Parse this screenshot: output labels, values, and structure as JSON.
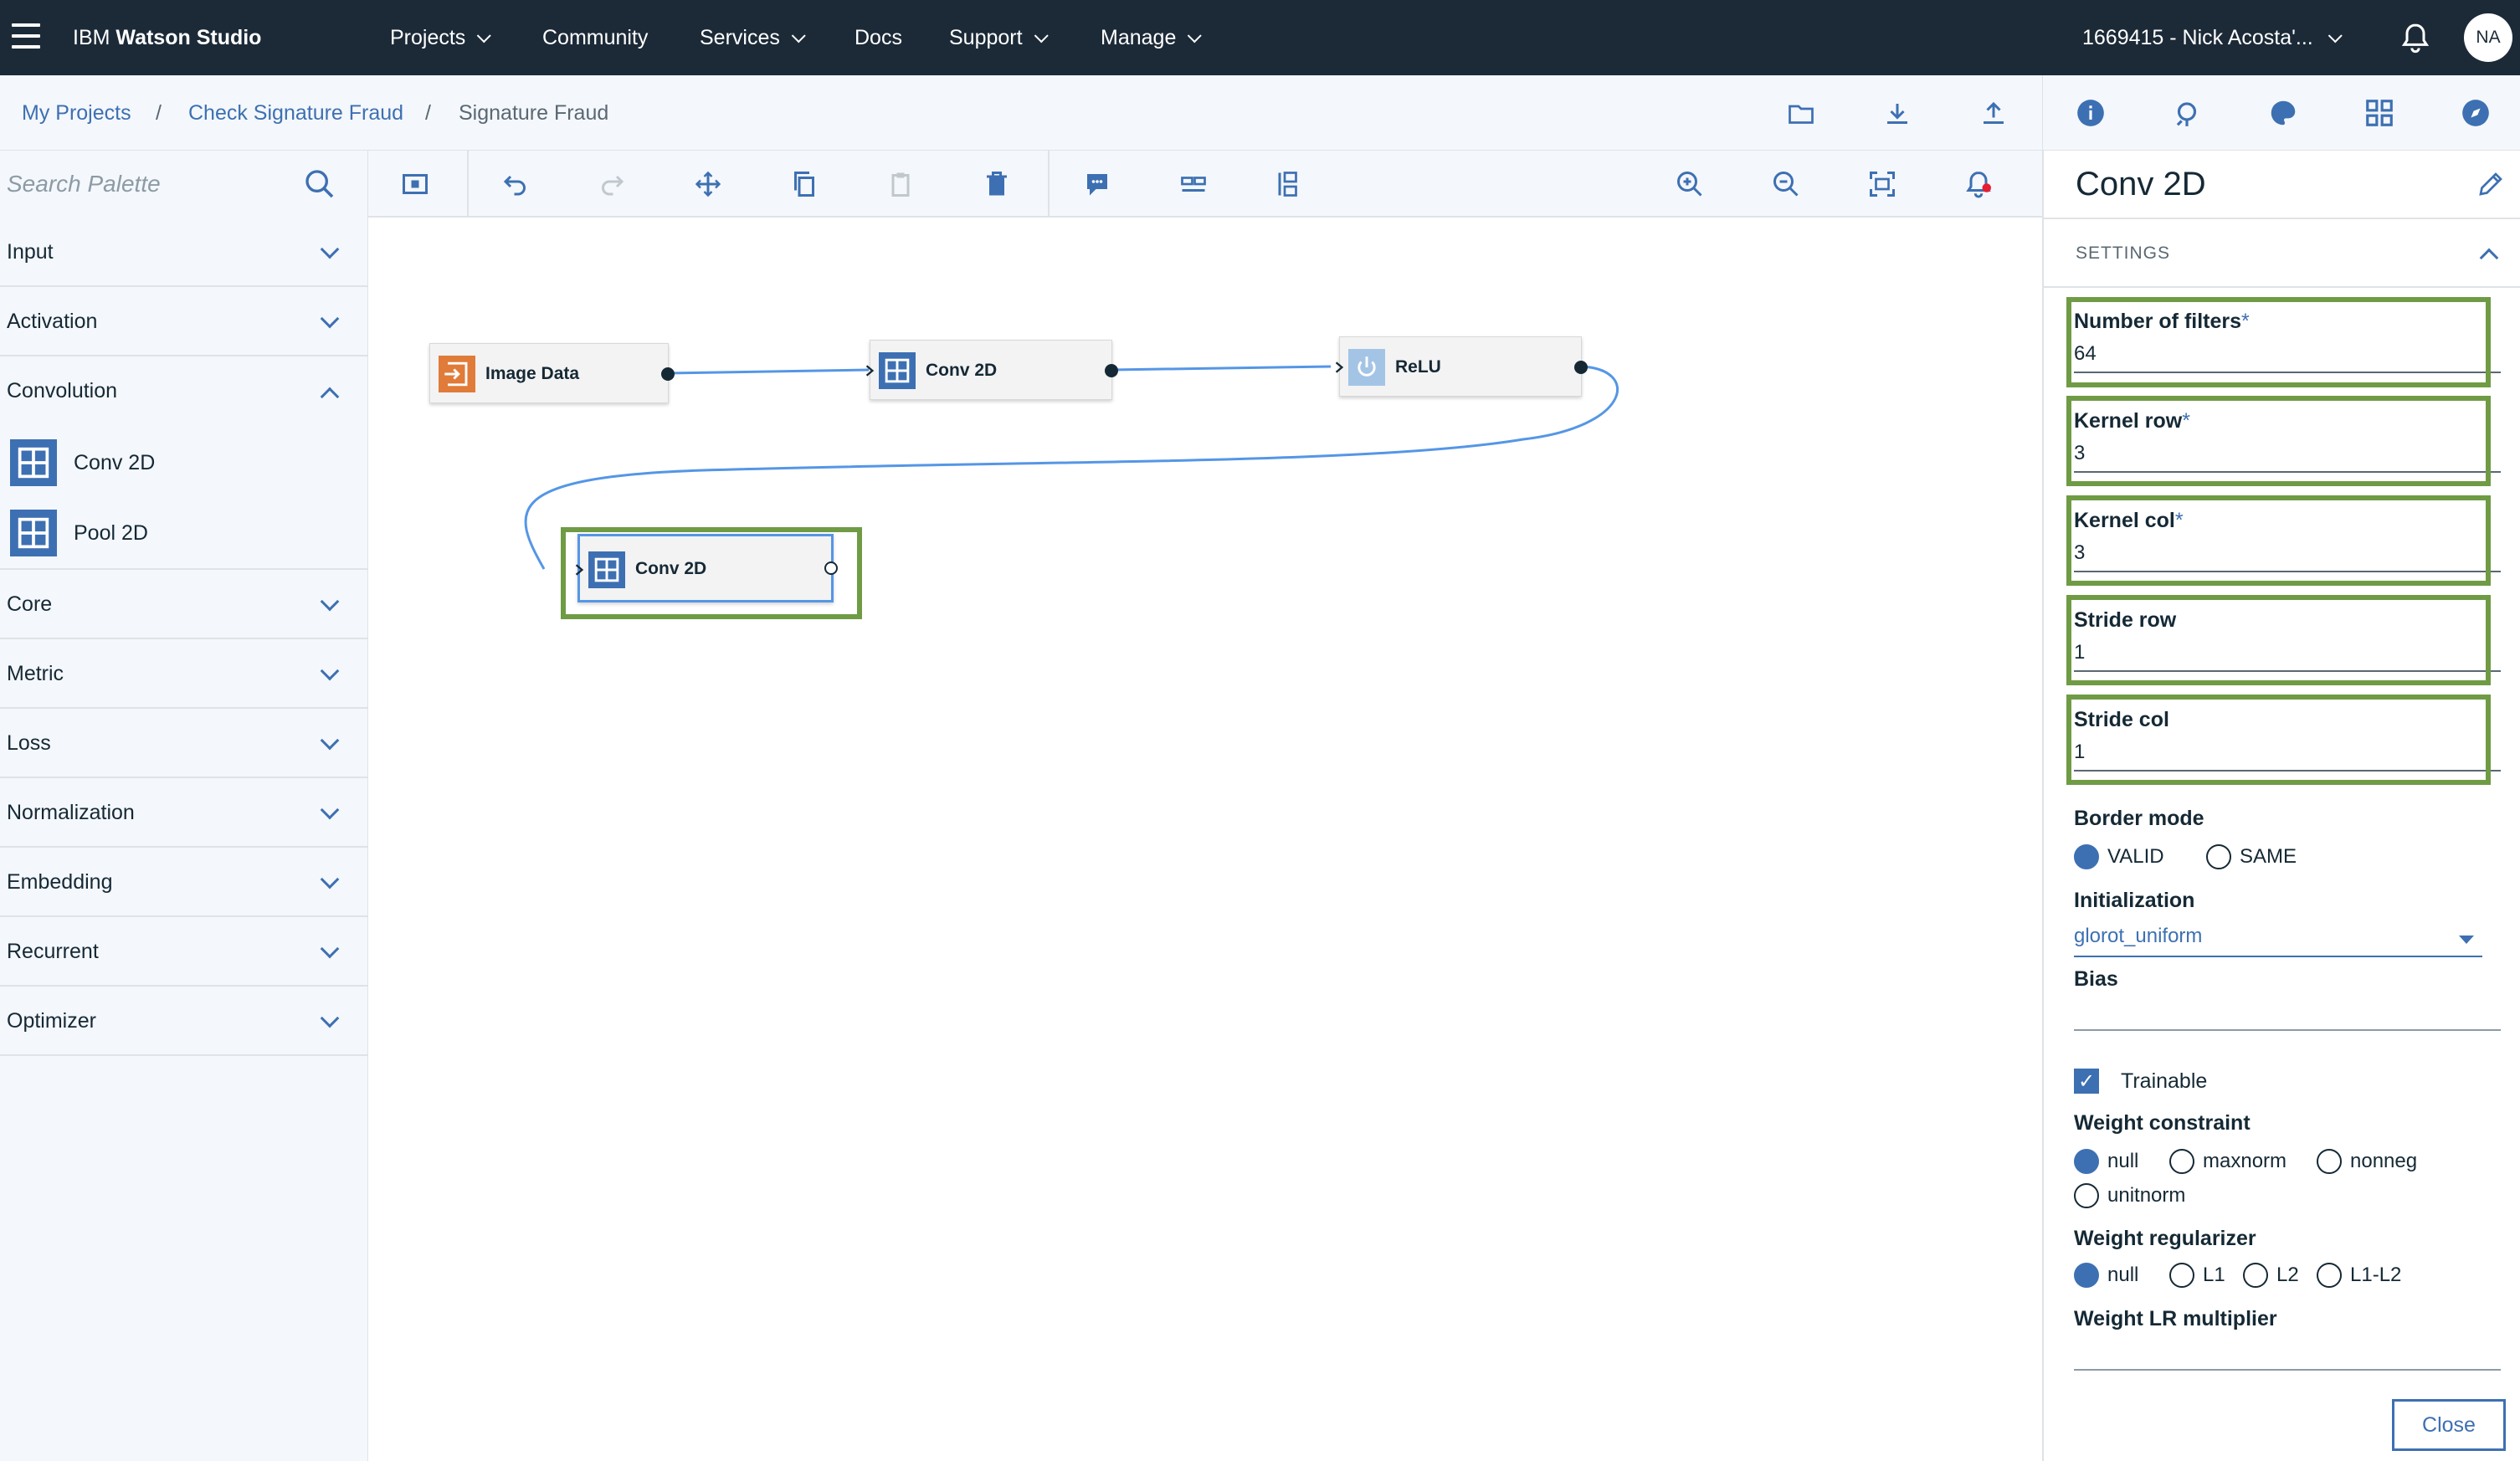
{
  "app": {
    "brand_prefix": "IBM ",
    "brand_name": "Watson Studio"
  },
  "nav": {
    "projects": "Projects",
    "community": "Community",
    "services": "Services",
    "docs": "Docs",
    "support": "Support",
    "manage": "Manage",
    "account": "1669415 - Nick Acosta'...",
    "avatar_initials": "NA"
  },
  "breadcrumb": {
    "my_projects": "My Projects",
    "project": "Check Signature Fraud",
    "current": "Signature Fraud",
    "separator": "/"
  },
  "palette": {
    "search_placeholder": "Search Palette",
    "categories": {
      "input": "Input",
      "activation": "Activation",
      "convolution": "Convolution",
      "core": "Core",
      "metric": "Metric",
      "loss": "Loss",
      "normalization": "Normalization",
      "embedding": "Embedding",
      "recurrent": "Recurrent",
      "optimizer": "Optimizer"
    },
    "convolution_items": [
      "Conv 2D",
      "Pool 2D"
    ]
  },
  "canvas": {
    "nodes": {
      "image_data": "Image Data",
      "conv2d_1": "Conv 2D",
      "relu": "ReLU",
      "conv2d_2": "Conv 2D"
    }
  },
  "props": {
    "title": "Conv 2D",
    "section": "SETTINGS",
    "required_mark": "*",
    "number_of_filters": {
      "label": "Number of filters",
      "value": "64"
    },
    "kernel_row": {
      "label": "Kernel row",
      "value": "3"
    },
    "kernel_col": {
      "label": "Kernel col",
      "value": "3"
    },
    "stride_row": {
      "label": "Stride row",
      "value": "1"
    },
    "stride_col": {
      "label": "Stride col",
      "value": "1"
    },
    "border_mode": {
      "label": "Border mode",
      "options": [
        "VALID",
        "SAME"
      ],
      "selected": "VALID"
    },
    "initialization": {
      "label": "Initialization",
      "value": "glorot_uniform"
    },
    "bias": {
      "label": "Bias",
      "value": ""
    },
    "trainable": {
      "label": "Trainable",
      "checked": true
    },
    "weight_constraint": {
      "label": "Weight constraint",
      "options": [
        "null",
        "maxnorm",
        "nonneg",
        "unitnorm"
      ],
      "selected": "null"
    },
    "weight_regularizer": {
      "label": "Weight regularizer",
      "options": [
        "null",
        "L1",
        "L2",
        "L1-L2"
      ],
      "selected": "null"
    },
    "weight_lr_multiplier": {
      "label": "Weight LR multiplier",
      "value": ""
    },
    "close_label": "Close"
  },
  "colors": {
    "topbar": "#1c2a38",
    "accent": "#3d70b2",
    "highlight": "#6f9b45",
    "image_data_icon": "#e07b39",
    "relu_icon": "#a3c4e5"
  }
}
